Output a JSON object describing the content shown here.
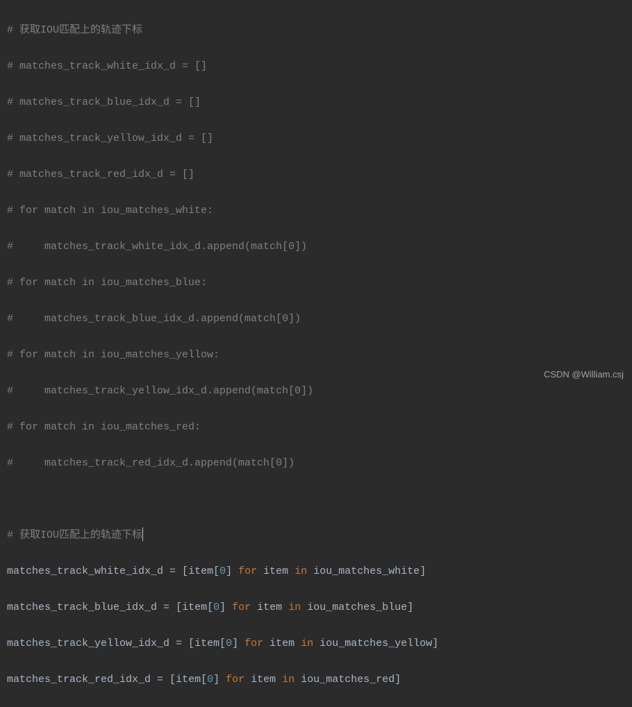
{
  "code": {
    "commented_block": {
      "line1": "# 获取IOU匹配上的轨迹下标",
      "line2": "# matches_track_white_idx_d = []",
      "line3": "# matches_track_blue_idx_d = []",
      "line4": "# matches_track_yellow_idx_d = []",
      "line5": "# matches_track_red_idx_d = []",
      "line6": "# for match in iou_matches_white:",
      "line7": "#     matches_track_white_idx_d.append(match[0])",
      "line8": "# for match in iou_matches_blue:",
      "line9": "#     matches_track_blue_idx_d.append(match[0])",
      "line10": "# for match in iou_matches_yellow:",
      "line11": "#     matches_track_yellow_idx_d.append(match[0])",
      "line12": "# for match in iou_matches_red:",
      "line13": "#     matches_track_red_idx_d.append(match[0])"
    },
    "active_block": {
      "comment": "# 获取IOU匹配上的轨迹下标",
      "assignments": [
        {
          "var": "matches_track_white_idx_d",
          "eq": " = [",
          "item": "item",
          "lb": "[",
          "idx": "0",
          "rb": "] ",
          "for": "for",
          "sp1": " ",
          "item2": "item",
          "sp2": " ",
          "in": "in",
          "sp3": " ",
          "src": "iou_matches_white",
          "close": "]"
        },
        {
          "var": "matches_track_blue_idx_d",
          "eq": " = [",
          "item": "item",
          "lb": "[",
          "idx": "0",
          "rb": "] ",
          "for": "for",
          "sp1": " ",
          "item2": "item",
          "sp2": " ",
          "in": "in",
          "sp3": " ",
          "src": "iou_matches_blue",
          "close": "]"
        },
        {
          "var": "matches_track_yellow_idx_d",
          "eq": " = [",
          "item": "item",
          "lb": "[",
          "idx": "0",
          "rb": "] ",
          "for": "for",
          "sp1": " ",
          "item2": "item",
          "sp2": " ",
          "in": "in",
          "sp3": " ",
          "src": "iou_matches_yellow",
          "close": "]"
        },
        {
          "var": "matches_track_red_idx_d",
          "eq": " = [",
          "item": "item",
          "lb": "[",
          "idx": "0",
          "rb": "] ",
          "for": "for",
          "sp1": " ",
          "item2": "item",
          "sp2": " ",
          "in": "in",
          "sp3": " ",
          "src": "iou_matches_red",
          "close": "]"
        }
      ]
    }
  },
  "watermark": "CSDN @William.csj"
}
